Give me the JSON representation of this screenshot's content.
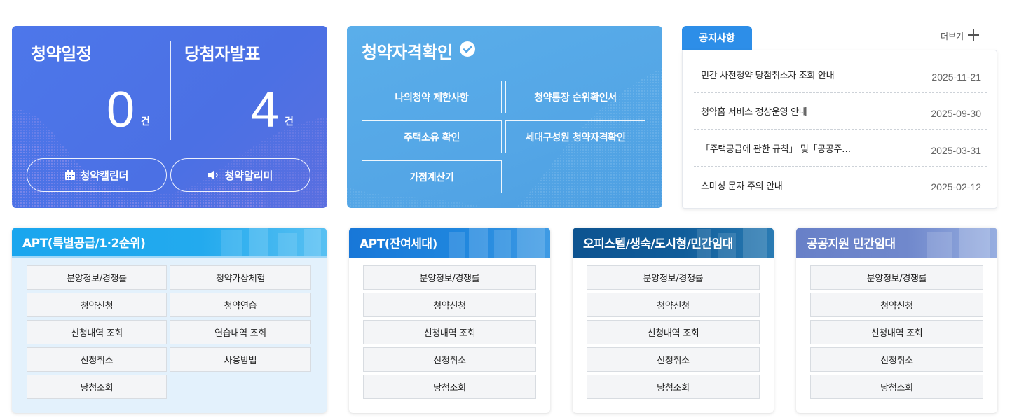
{
  "schedule_card": {
    "left_title": "청약일정",
    "left_count": "0",
    "left_unit": "건",
    "right_title": "당첨자발표",
    "right_count": "4",
    "right_unit": "건",
    "calendar_button": "청약캘린더",
    "calendar_icon": "calendar-icon",
    "alarm_button": "청약알리미",
    "alarm_icon": "speaker-icon"
  },
  "eligibility_card": {
    "title": "청약자격확인",
    "check_icon": "check-circle-icon",
    "buttons": [
      "나의청약 제한사항",
      "청약통장 순위확인서",
      "주택소유 확인",
      "세대구성원 청약자격확인",
      "가점계산기"
    ]
  },
  "notice": {
    "tab_label": "공지사항",
    "more_label": "더보기",
    "items": [
      {
        "title": "민간 사전청약 당첨취소자 조회 안내",
        "date": "2025-11-21"
      },
      {
        "title": "청약홈 서비스 정상운영 안내",
        "date": "2025-09-30"
      },
      {
        "title": "「주택공급에 관한 규칙」 및「공공주…",
        "date": "2025-03-31"
      },
      {
        "title": "스미싱 문자 주의 안내",
        "date": "2025-02-12"
      }
    ]
  },
  "services": [
    {
      "title": "APT(특별공급/1·2순위)",
      "items": [
        "분양정보/경쟁률",
        "청약가상체험",
        "청약신청",
        "청약연습",
        "신청내역 조회",
        "연습내역 조회",
        "신청취소",
        "사용방법",
        "당첨조회"
      ]
    },
    {
      "title": "APT(잔여세대)",
      "items": [
        "분양정보/경쟁률",
        "청약신청",
        "신청내역 조회",
        "신청취소",
        "당첨조회"
      ]
    },
    {
      "title": "오피스텔/생숙/도시형/민간임대",
      "items": [
        "분양정보/경쟁률",
        "청약신청",
        "신청내역 조회",
        "신청취소",
        "당첨조회"
      ]
    },
    {
      "title": "공공지원 민간임대",
      "items": [
        "분양정보/경쟁률",
        "청약신청",
        "신청내역 조회",
        "신청취소",
        "당첨조회"
      ]
    }
  ],
  "colors": {
    "schedule_bg": "#4b72e6",
    "eligibility_bg": "#55a7e7",
    "notice_tab": "#2d8ee8",
    "apt_special_head": "#1ea3ec",
    "apt_special_body": "#e3f1fc",
    "apt_remaining_head": "#1f84de",
    "officetel_head": "#0f5b96",
    "public_rental_head": "#6f86cc"
  }
}
